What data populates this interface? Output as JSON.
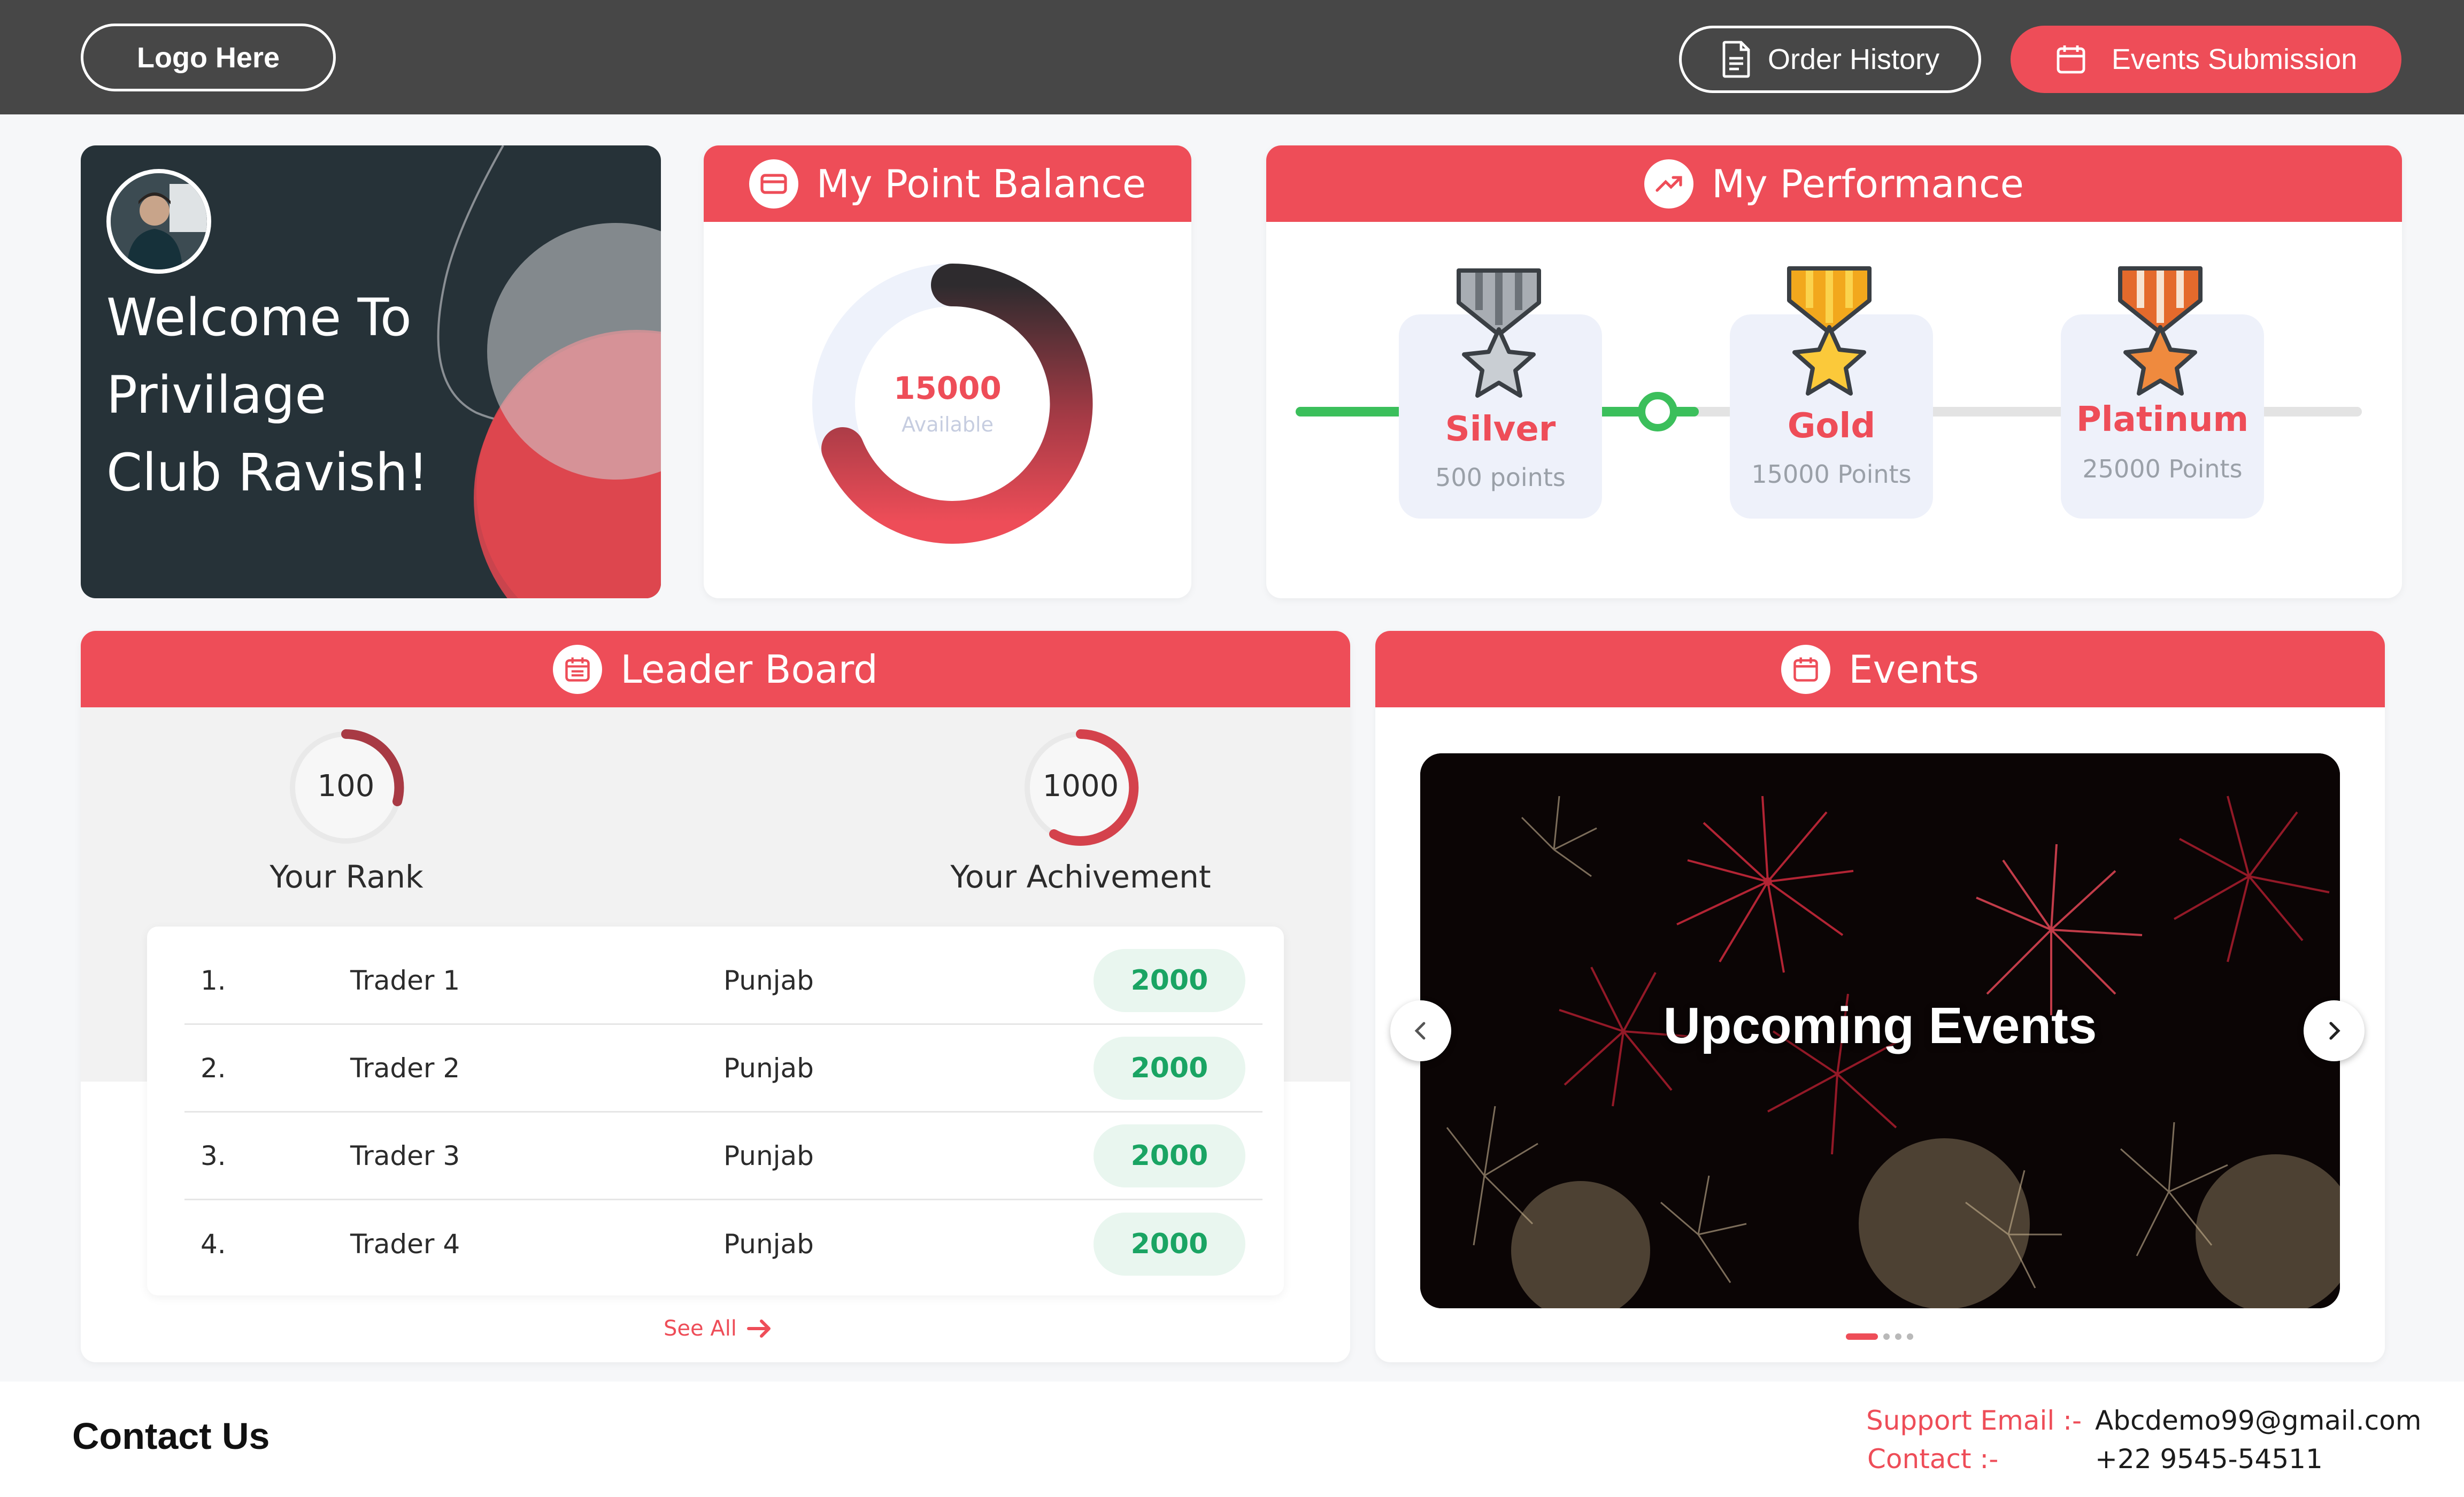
{
  "header": {
    "logo_label": "Logo Here",
    "order_history_label": "Order History",
    "events_submission_label": "Events Submission"
  },
  "welcome": {
    "line1": "Welcome To",
    "line2": "Privilage",
    "line3": "Club Ravish!"
  },
  "point_balance": {
    "title": "My Point Balance",
    "value": "15000",
    "caption": "Available"
  },
  "performance": {
    "title": "My Performance",
    "tiers": [
      {
        "name": "Silver",
        "points": "500 points"
      },
      {
        "name": "Gold",
        "points": "15000 Points"
      },
      {
        "name": "Platinum",
        "points": "25000 Points"
      }
    ]
  },
  "leaderboard": {
    "title": "Leader Board",
    "rank_value": "100",
    "rank_label": "Your Rank",
    "achievement_value": "1000",
    "achievement_label": "Your Achivement",
    "rows": [
      {
        "num": "1.",
        "name": "Trader 1",
        "region": "Punjab",
        "points": "2000"
      },
      {
        "num": "2.",
        "name": "Trader 2",
        "region": "Punjab",
        "points": "2000"
      },
      {
        "num": "3.",
        "name": "Trader 3",
        "region": "Punjab",
        "points": "2000"
      },
      {
        "num": "4.",
        "name": "Trader 4",
        "region": "Punjab",
        "points": "2000"
      }
    ],
    "see_all": "See All"
  },
  "events": {
    "title": "Events",
    "banner_text": "Upcoming Events"
  },
  "footer": {
    "contact_us": "Contact Us",
    "support_email_label": "Support Email :-",
    "support_email": "Abcdemo99@gmail.com",
    "contact_label": "Contact :-",
    "contact_value": "+22 9545-54511"
  },
  "colors": {
    "accent": "#ee4d58",
    "topbar": "#474747",
    "welcome_bg": "#263238",
    "success": "#1aa463"
  }
}
